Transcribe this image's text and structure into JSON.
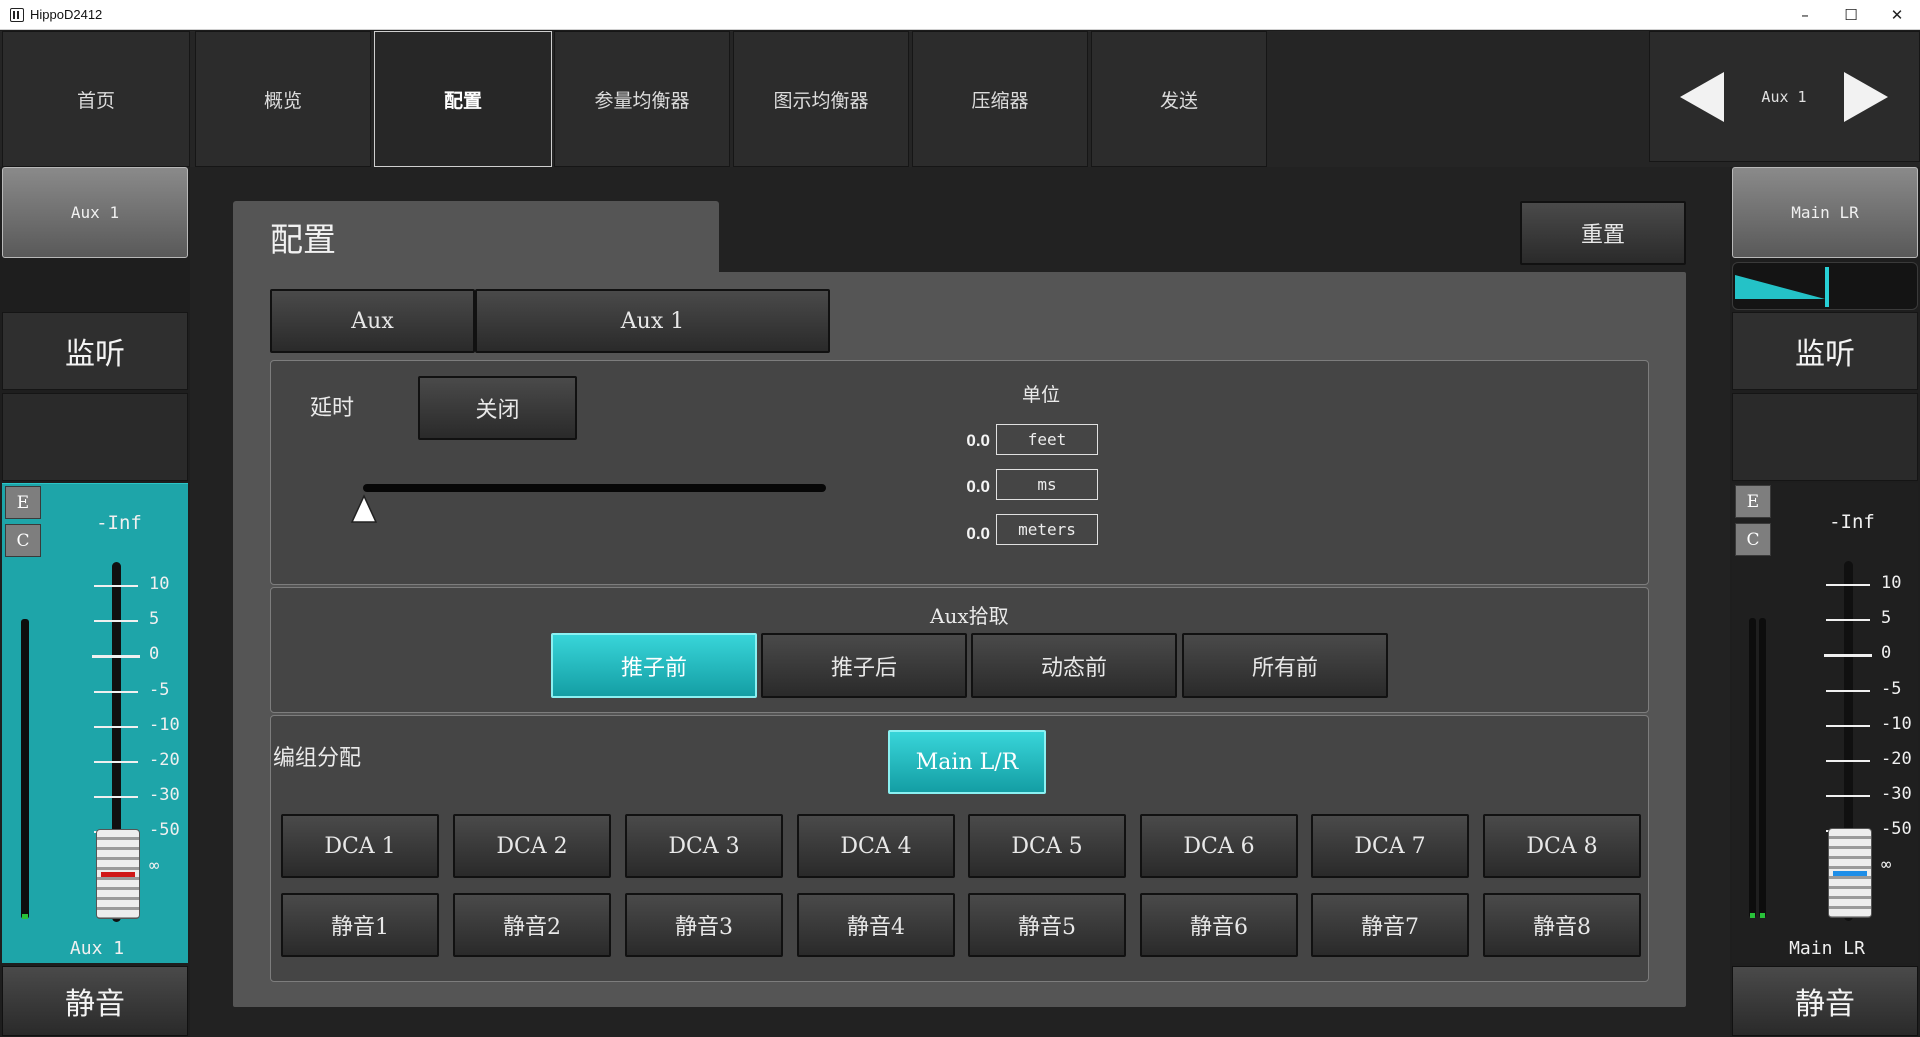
{
  "window": {
    "title": "HippoD2412",
    "minimize": "–",
    "maximize": "☐",
    "close": "✕"
  },
  "nav": {
    "home": "首页",
    "tabs": [
      "概览",
      "配置",
      "参量均衡器",
      "图示均衡器",
      "压缩器",
      "发送"
    ],
    "active_tab": "配置",
    "channel": "Aux 1"
  },
  "left_strip": {
    "channel_button": "Aux 1",
    "monitor": "监听",
    "e_label": "E",
    "c_label": "C",
    "level": "-Inf",
    "scale": [
      "10",
      "5",
      "0",
      "-5",
      "-10",
      "-20",
      "-30",
      "-50",
      "∞"
    ],
    "name": "Aux 1",
    "mute": "静音",
    "fader_db": "-∞",
    "strip_color": "#1ea5a9"
  },
  "right_strip": {
    "channel_button": "Main LR",
    "monitor": "监听",
    "e_label": "E",
    "c_label": "C",
    "level": "-Inf",
    "scale": [
      "10",
      "5",
      "0",
      "-5",
      "-10",
      "-20",
      "-30",
      "-50",
      "∞"
    ],
    "name": "Main LR",
    "mute": "静音",
    "fader_db": "-∞",
    "send_level_fraction": 0.5
  },
  "panel": {
    "title": "配置",
    "reset": "重置",
    "channel_type": "Aux",
    "channel_name": "Aux 1",
    "delay": {
      "label": "延时",
      "toggle": "关闭",
      "slider_value": 0,
      "unit_title": "单位",
      "units": [
        {
          "value": "0.0",
          "unit": "feet"
        },
        {
          "value": "0.0",
          "unit": "ms"
        },
        {
          "value": "0.0",
          "unit": "meters"
        }
      ]
    },
    "aux_pick": {
      "title": "Aux拾取",
      "options": [
        "推子前",
        "推子后",
        "动态前",
        "所有前"
      ],
      "selected": "推子前"
    },
    "group": {
      "title": "编组分配",
      "main_lr": "Main L/R",
      "main_lr_active": true,
      "dca": [
        "DCA 1",
        "DCA 2",
        "DCA 3",
        "DCA 4",
        "DCA 5",
        "DCA 6",
        "DCA 7",
        "DCA 8"
      ],
      "mute_groups": [
        "静音1",
        "静音2",
        "静音3",
        "静音4",
        "静音5",
        "静音6",
        "静音7",
        "静音8"
      ]
    }
  },
  "colors": {
    "accent": "#1ea5a9",
    "accent_button": "#2ad0d4",
    "panel": "#555555"
  }
}
